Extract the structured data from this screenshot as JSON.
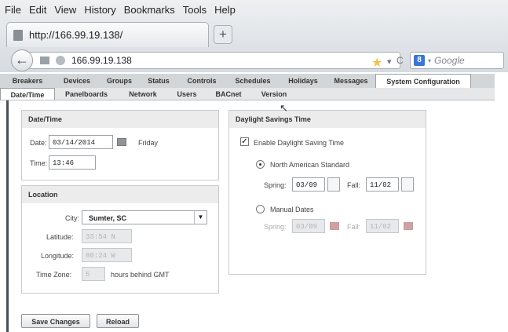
{
  "browser": {
    "menu": [
      "File",
      "Edit",
      "View",
      "History",
      "Bookmarks",
      "Tools",
      "Help"
    ],
    "tab_title": "http://166.99.19.138/",
    "new_tab": "+",
    "url": "166.99.19.138",
    "search_placeholder": "Google",
    "search_engine_letter": "8"
  },
  "app_tabs": [
    "Breakers",
    "Devices",
    "Groups",
    "Status",
    "Controls",
    "Schedules",
    "Holidays",
    "Messages",
    "System Configuration"
  ],
  "sub_tabs": [
    "Date/Time",
    "Panelboards",
    "Network",
    "Users",
    "BACnet",
    "Version"
  ],
  "datetime": {
    "heading": "Date/Time",
    "date_label": "Date:",
    "date_value": "03/14/2014",
    "day": "Friday",
    "time_label": "Time:",
    "time_value": "13:46"
  },
  "location": {
    "heading": "Location",
    "city_label": "City:",
    "city_value": "Sumter, SC",
    "latitude_label": "Latitude:",
    "latitude_value": "33:54 N",
    "longitude_label": "Longitude:",
    "longitude_value": "80:24 W",
    "timezone_label": "Time Zone:",
    "timezone_value": "5",
    "timezone_suffix": "hours behind GMT"
  },
  "dst": {
    "heading": "Daylight Savings Time",
    "enable_label": "Enable Daylight Saving Time",
    "enabled": true,
    "north_american_label": "North American Standard",
    "spring_label": "Spring:",
    "spring_value": "03/09",
    "fall_label": "Fall:",
    "fall_value": "11/02",
    "manual_label": "Manual Dates",
    "manual_spring_label": "Spring:",
    "manual_spring_value": "03/09",
    "manual_fall_label": "Fall:",
    "manual_fall_value": "11/02"
  },
  "buttons": {
    "save": "Save Changes",
    "reload": "Reload"
  }
}
